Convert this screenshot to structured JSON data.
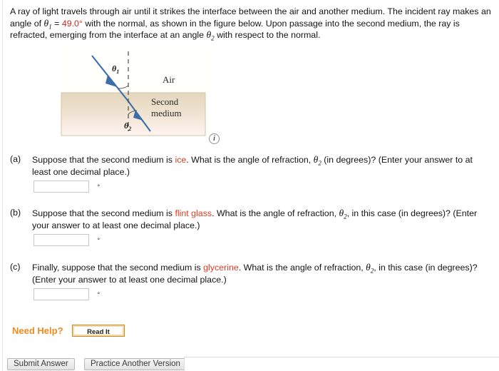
{
  "prompt": {
    "line1_a": "A ray of light travels through air until it strikes the interface between the air and another medium. The incident ray makes",
    "line2_a": "an angle of ",
    "theta1": "θ",
    "theta1_sub": "1",
    "eq": " = ",
    "angle_value": "49.0°",
    "line2_b": " with the normal, as shown in the figure below. Upon passage into the second medium, the ray is",
    "line3_a": "refracted, emerging from the interface at an angle ",
    "theta2": "θ",
    "theta2_sub": "2",
    "line3_b": " with respect to the normal."
  },
  "figure": {
    "air_label": "Air",
    "medium_label_line1": "Second",
    "medium_label_line2": "medium",
    "theta1_label": "θ",
    "theta1_sub": "1",
    "theta2_label": "θ",
    "theta2_sub": "2",
    "info_icon": "i",
    "ray_color": "#3c6ea8",
    "medium_top_color": "#e6d8c0",
    "medium_bottom_color": "#fbf1ec",
    "frame_color": "#cdbda3"
  },
  "parts": [
    {
      "label": "(a)",
      "text_line1_a": "Suppose that the second medium is ",
      "highlight": "ice",
      "text_line1_b": ". What is the angle of refraction, ",
      "theta": "θ",
      "theta_sub": "2",
      "text_line1_c": " (in degrees)? (Enter your answer to at",
      "text_line2": "least one decimal place.)",
      "input_value": "",
      "input_placeholder": "",
      "unit": "°"
    },
    {
      "label": "(b)",
      "text_line1_a": "Suppose that the second medium is ",
      "highlight": "flint glass",
      "text_line1_b": ". What is the angle of refraction, ",
      "theta": "θ",
      "theta_sub": "2",
      "text_line1_c": ", in this case (in degrees)? (Enter",
      "text_line2": "your answer to at least one decimal place.)",
      "input_value": "",
      "input_placeholder": "",
      "unit": "°"
    },
    {
      "label": "(c)",
      "text_line1_a": "Finally, suppose that the second medium is ",
      "highlight": "glycerine",
      "text_line1_b": ". What is the angle of refraction, ",
      "theta": "θ",
      "theta_sub": "2",
      "text_line1_c": ", in this case (in degrees)?",
      "text_line2": "(Enter your answer to at least one decimal place.)",
      "input_value": "",
      "input_placeholder": "",
      "unit": "°"
    }
  ],
  "need_help": {
    "label": "Need Help?",
    "read_it_button": "Read It"
  },
  "footer": {
    "submit_label": "Submit Answer",
    "practice_label": "Practice Another Version"
  },
  "colors": {
    "highlight_red": "#e03b20",
    "value_red": "#cc2b20",
    "need_help_orange": "#f08a1e"
  }
}
